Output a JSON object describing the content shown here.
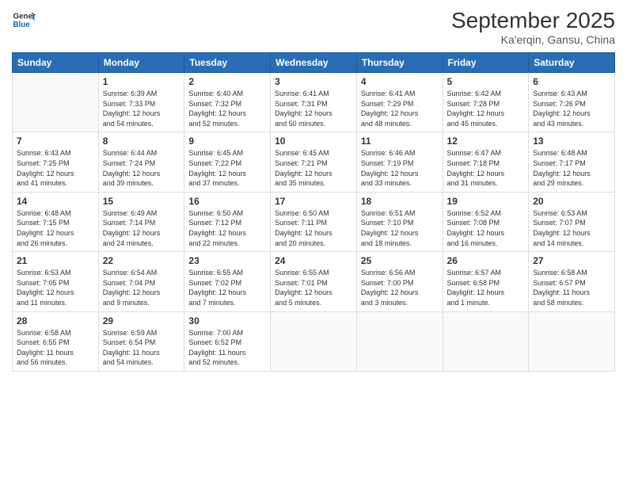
{
  "logo": {
    "line1": "General",
    "line2": "Blue"
  },
  "title": "September 2025",
  "location": "Ka'erqin, Gansu, China",
  "days_header": [
    "Sunday",
    "Monday",
    "Tuesday",
    "Wednesday",
    "Thursday",
    "Friday",
    "Saturday"
  ],
  "weeks": [
    [
      {
        "num": "",
        "info": ""
      },
      {
        "num": "1",
        "info": "Sunrise: 6:39 AM\nSunset: 7:33 PM\nDaylight: 12 hours\nand 54 minutes."
      },
      {
        "num": "2",
        "info": "Sunrise: 6:40 AM\nSunset: 7:32 PM\nDaylight: 12 hours\nand 52 minutes."
      },
      {
        "num": "3",
        "info": "Sunrise: 6:41 AM\nSunset: 7:31 PM\nDaylight: 12 hours\nand 50 minutes."
      },
      {
        "num": "4",
        "info": "Sunrise: 6:41 AM\nSunset: 7:29 PM\nDaylight: 12 hours\nand 48 minutes."
      },
      {
        "num": "5",
        "info": "Sunrise: 6:42 AM\nSunset: 7:28 PM\nDaylight: 12 hours\nand 45 minutes."
      },
      {
        "num": "6",
        "info": "Sunrise: 6:43 AM\nSunset: 7:26 PM\nDaylight: 12 hours\nand 43 minutes."
      }
    ],
    [
      {
        "num": "7",
        "info": "Sunrise: 6:43 AM\nSunset: 7:25 PM\nDaylight: 12 hours\nand 41 minutes."
      },
      {
        "num": "8",
        "info": "Sunrise: 6:44 AM\nSunset: 7:24 PM\nDaylight: 12 hours\nand 39 minutes."
      },
      {
        "num": "9",
        "info": "Sunrise: 6:45 AM\nSunset: 7:22 PM\nDaylight: 12 hours\nand 37 minutes."
      },
      {
        "num": "10",
        "info": "Sunrise: 6:45 AM\nSunset: 7:21 PM\nDaylight: 12 hours\nand 35 minutes."
      },
      {
        "num": "11",
        "info": "Sunrise: 6:46 AM\nSunset: 7:19 PM\nDaylight: 12 hours\nand 33 minutes."
      },
      {
        "num": "12",
        "info": "Sunrise: 6:47 AM\nSunset: 7:18 PM\nDaylight: 12 hours\nand 31 minutes."
      },
      {
        "num": "13",
        "info": "Sunrise: 6:48 AM\nSunset: 7:17 PM\nDaylight: 12 hours\nand 29 minutes."
      }
    ],
    [
      {
        "num": "14",
        "info": "Sunrise: 6:48 AM\nSunset: 7:15 PM\nDaylight: 12 hours\nand 26 minutes."
      },
      {
        "num": "15",
        "info": "Sunrise: 6:49 AM\nSunset: 7:14 PM\nDaylight: 12 hours\nand 24 minutes."
      },
      {
        "num": "16",
        "info": "Sunrise: 6:50 AM\nSunset: 7:12 PM\nDaylight: 12 hours\nand 22 minutes."
      },
      {
        "num": "17",
        "info": "Sunrise: 6:50 AM\nSunset: 7:11 PM\nDaylight: 12 hours\nand 20 minutes."
      },
      {
        "num": "18",
        "info": "Sunrise: 6:51 AM\nSunset: 7:10 PM\nDaylight: 12 hours\nand 18 minutes."
      },
      {
        "num": "19",
        "info": "Sunrise: 6:52 AM\nSunset: 7:08 PM\nDaylight: 12 hours\nand 16 minutes."
      },
      {
        "num": "20",
        "info": "Sunrise: 6:53 AM\nSunset: 7:07 PM\nDaylight: 12 hours\nand 14 minutes."
      }
    ],
    [
      {
        "num": "21",
        "info": "Sunrise: 6:53 AM\nSunset: 7:05 PM\nDaylight: 12 hours\nand 11 minutes."
      },
      {
        "num": "22",
        "info": "Sunrise: 6:54 AM\nSunset: 7:04 PM\nDaylight: 12 hours\nand 9 minutes."
      },
      {
        "num": "23",
        "info": "Sunrise: 6:55 AM\nSunset: 7:02 PM\nDaylight: 12 hours\nand 7 minutes."
      },
      {
        "num": "24",
        "info": "Sunrise: 6:55 AM\nSunset: 7:01 PM\nDaylight: 12 hours\nand 5 minutes."
      },
      {
        "num": "25",
        "info": "Sunrise: 6:56 AM\nSunset: 7:00 PM\nDaylight: 12 hours\nand 3 minutes."
      },
      {
        "num": "26",
        "info": "Sunrise: 6:57 AM\nSunset: 6:58 PM\nDaylight: 12 hours\nand 1 minute."
      },
      {
        "num": "27",
        "info": "Sunrise: 6:58 AM\nSunset: 6:57 PM\nDaylight: 11 hours\nand 58 minutes."
      }
    ],
    [
      {
        "num": "28",
        "info": "Sunrise: 6:58 AM\nSunset: 6:55 PM\nDaylight: 11 hours\nand 56 minutes."
      },
      {
        "num": "29",
        "info": "Sunrise: 6:59 AM\nSunset: 6:54 PM\nDaylight: 11 hours\nand 54 minutes."
      },
      {
        "num": "30",
        "info": "Sunrise: 7:00 AM\nSunset: 6:52 PM\nDaylight: 11 hours\nand 52 minutes."
      },
      {
        "num": "",
        "info": ""
      },
      {
        "num": "",
        "info": ""
      },
      {
        "num": "",
        "info": ""
      },
      {
        "num": "",
        "info": ""
      }
    ]
  ]
}
